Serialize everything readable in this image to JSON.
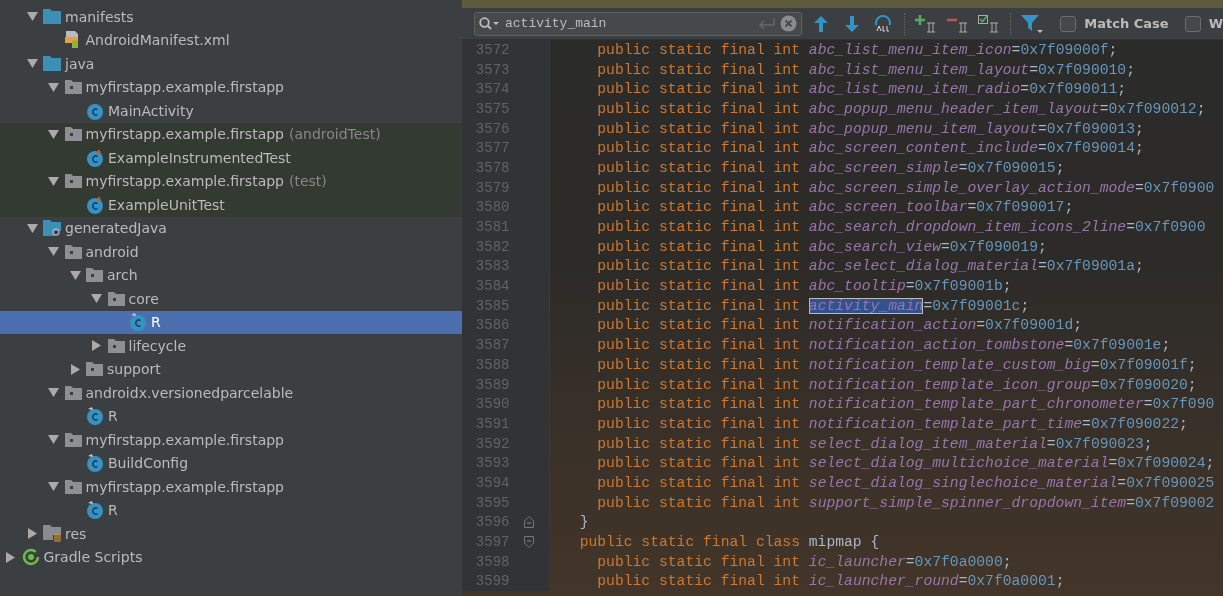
{
  "project_tree": [
    {
      "label": "manifests",
      "kind": "source-folder",
      "expanded": true,
      "selected": false,
      "test_scope": false,
      "children": [
        {
          "label": "AndroidManifest.xml",
          "kind": "manifest",
          "selected": false,
          "test_scope": false
        }
      ]
    },
    {
      "label": "java",
      "kind": "source-folder",
      "expanded": true,
      "selected": false,
      "test_scope": false,
      "children": [
        {
          "label": "myfirstapp.example.firstapp",
          "kind": "package",
          "expanded": true,
          "selected": false,
          "test_scope": false,
          "children": [
            {
              "label": "MainActivity",
              "kind": "class",
              "selected": false,
              "test_scope": false
            }
          ]
        },
        {
          "label": "myfirstapp.example.firstapp",
          "suffix": "(androidTest)",
          "kind": "package",
          "expanded": true,
          "selected": false,
          "test_scope": true,
          "children": [
            {
              "label": "ExampleInstrumentedTest",
              "kind": "test-class",
              "selected": false,
              "test_scope": true
            }
          ]
        },
        {
          "label": "myfirstapp.example.firstapp",
          "suffix": "(test)",
          "kind": "package",
          "expanded": true,
          "selected": false,
          "test_scope": true,
          "children": [
            {
              "label": "ExampleUnitTest",
              "kind": "test-class",
              "selected": false,
              "test_scope": true
            }
          ]
        }
      ]
    },
    {
      "label": "generatedJava",
      "kind": "generated-folder",
      "expanded": true,
      "selected": false,
      "test_scope": false,
      "children": [
        {
          "label": "android",
          "kind": "package",
          "expanded": true,
          "selected": false,
          "test_scope": false,
          "children": [
            {
              "label": "arch",
              "kind": "package",
              "expanded": true,
              "selected": false,
              "test_scope": false,
              "children": [
                {
                  "label": "core",
                  "kind": "package",
                  "expanded": true,
                  "selected": false,
                  "test_scope": false,
                  "children": [
                    {
                      "label": "R",
                      "kind": "generated-class",
                      "selected": true,
                      "test_scope": false
                    }
                  ]
                },
                {
                  "label": "lifecycle",
                  "kind": "package",
                  "expanded": false,
                  "selected": false,
                  "test_scope": false
                }
              ]
            },
            {
              "label": "support",
              "kind": "package",
              "expanded": false,
              "selected": false,
              "test_scope": false
            }
          ]
        },
        {
          "label": "androidx.versionedparcelable",
          "kind": "package",
          "expanded": true,
          "selected": false,
          "test_scope": false,
          "children": [
            {
              "label": "R",
              "kind": "generated-class",
              "selected": false,
              "test_scope": false
            }
          ]
        },
        {
          "label": "myfirstapp.example.firstapp",
          "kind": "package",
          "expanded": true,
          "selected": false,
          "test_scope": false,
          "children": [
            {
              "label": "BuildConfig",
              "kind": "generated-class",
              "selected": false,
              "test_scope": false
            }
          ]
        },
        {
          "label": "myfirstapp.example.firstapp",
          "kind": "package",
          "expanded": true,
          "selected": false,
          "test_scope": false,
          "children": [
            {
              "label": "R",
              "kind": "generated-class",
              "selected": false,
              "test_scope": false
            }
          ]
        }
      ]
    },
    {
      "label": "res",
      "kind": "resource-folder",
      "expanded": false,
      "selected": false,
      "test_scope": false
    }
  ],
  "gradle_scripts": {
    "label": "Gradle Scripts",
    "expanded": false
  },
  "search": {
    "value": "activity_main",
    "options": [
      {
        "label": "Match Case",
        "checked": false
      },
      {
        "label": "W",
        "checked": false
      }
    ]
  },
  "code": [
    {
      "number": "3572",
      "kind": "member",
      "parts": [
        {
          "kind": "keyword",
          "text": "public static final int"
        },
        {
          "kind": "field",
          "text": "abc_list_menu_item_icon"
        },
        {
          "kind": "plain",
          "text": "="
        },
        {
          "kind": "number",
          "text": "0x7f09000f"
        },
        {
          "kind": "plain",
          "text": ";"
        }
      ]
    },
    {
      "number": "3573",
      "kind": "member",
      "parts": [
        {
          "kind": "keyword",
          "text": "public static final int"
        },
        {
          "kind": "field",
          "text": "abc_list_menu_item_layout"
        },
        {
          "kind": "plain",
          "text": "="
        },
        {
          "kind": "number",
          "text": "0x7f090010"
        },
        {
          "kind": "plain",
          "text": ";"
        }
      ]
    },
    {
      "number": "3574",
      "kind": "member",
      "parts": [
        {
          "kind": "keyword",
          "text": "public static final int"
        },
        {
          "kind": "field",
          "text": "abc_list_menu_item_radio"
        },
        {
          "kind": "plain",
          "text": "="
        },
        {
          "kind": "number",
          "text": "0x7f090011"
        },
        {
          "kind": "plain",
          "text": ";"
        }
      ]
    },
    {
      "number": "3575",
      "kind": "member",
      "parts": [
        {
          "kind": "keyword",
          "text": "public static final int"
        },
        {
          "kind": "field",
          "text": "abc_popup_menu_header_item_layout"
        },
        {
          "kind": "plain",
          "text": "="
        },
        {
          "kind": "number",
          "text": "0x7f090012"
        },
        {
          "kind": "plain",
          "text": ";"
        }
      ]
    },
    {
      "number": "3576",
      "kind": "member",
      "parts": [
        {
          "kind": "keyword",
          "text": "public static final int"
        },
        {
          "kind": "field",
          "text": "abc_popup_menu_item_layout"
        },
        {
          "kind": "plain",
          "text": "="
        },
        {
          "kind": "number",
          "text": "0x7f090013"
        },
        {
          "kind": "plain",
          "text": ";"
        }
      ]
    },
    {
      "number": "3577",
      "kind": "member",
      "parts": [
        {
          "kind": "keyword",
          "text": "public static final int"
        },
        {
          "kind": "field",
          "text": "abc_screen_content_include"
        },
        {
          "kind": "plain",
          "text": "="
        },
        {
          "kind": "number",
          "text": "0x7f090014"
        },
        {
          "kind": "plain",
          "text": ";"
        }
      ]
    },
    {
      "number": "3578",
      "kind": "member",
      "parts": [
        {
          "kind": "keyword",
          "text": "public static final int"
        },
        {
          "kind": "field",
          "text": "abc_screen_simple"
        },
        {
          "kind": "plain",
          "text": "="
        },
        {
          "kind": "number",
          "text": "0x7f090015"
        },
        {
          "kind": "plain",
          "text": ";"
        }
      ]
    },
    {
      "number": "3579",
      "kind": "member",
      "parts": [
        {
          "kind": "keyword",
          "text": "public static final int"
        },
        {
          "kind": "field",
          "text": "abc_screen_simple_overlay_action_mode"
        },
        {
          "kind": "plain",
          "text": "="
        },
        {
          "kind": "number",
          "text": "0x7f0900"
        }
      ]
    },
    {
      "number": "3580",
      "kind": "member",
      "parts": [
        {
          "kind": "keyword",
          "text": "public static final int"
        },
        {
          "kind": "field",
          "text": "abc_screen_toolbar"
        },
        {
          "kind": "plain",
          "text": "="
        },
        {
          "kind": "number",
          "text": "0x7f090017"
        },
        {
          "kind": "plain",
          "text": ";"
        }
      ]
    },
    {
      "number": "3581",
      "kind": "member",
      "parts": [
        {
          "kind": "keyword",
          "text": "public static final int"
        },
        {
          "kind": "field",
          "text": "abc_search_dropdown_item_icons_2line"
        },
        {
          "kind": "plain",
          "text": "="
        },
        {
          "kind": "number",
          "text": "0x7f0900"
        }
      ]
    },
    {
      "number": "3582",
      "kind": "member",
      "parts": [
        {
          "kind": "keyword",
          "text": "public static final int"
        },
        {
          "kind": "field",
          "text": "abc_search_view"
        },
        {
          "kind": "plain",
          "text": "="
        },
        {
          "kind": "number",
          "text": "0x7f090019"
        },
        {
          "kind": "plain",
          "text": ";"
        }
      ]
    },
    {
      "number": "3583",
      "kind": "member",
      "parts": [
        {
          "kind": "keyword",
          "text": "public static final int"
        },
        {
          "kind": "field",
          "text": "abc_select_dialog_material"
        },
        {
          "kind": "plain",
          "text": "="
        },
        {
          "kind": "number",
          "text": "0x7f09001a"
        },
        {
          "kind": "plain",
          "text": ";"
        }
      ]
    },
    {
      "number": "3584",
      "kind": "member",
      "parts": [
        {
          "kind": "keyword",
          "text": "public static final int"
        },
        {
          "kind": "field",
          "text": "abc_tooltip"
        },
        {
          "kind": "plain",
          "text": "="
        },
        {
          "kind": "number",
          "text": "0x7f09001b"
        },
        {
          "kind": "plain",
          "text": ";"
        }
      ]
    },
    {
      "number": "3585",
      "kind": "member",
      "parts": [
        {
          "kind": "keyword",
          "text": "public static final int"
        },
        {
          "kind": "match",
          "text": "activity_main"
        },
        {
          "kind": "plain",
          "text": "="
        },
        {
          "kind": "number",
          "text": "0x7f09001c"
        },
        {
          "kind": "plain",
          "text": ";"
        }
      ]
    },
    {
      "number": "3586",
      "kind": "member",
      "parts": [
        {
          "kind": "keyword",
          "text": "public static final int"
        },
        {
          "kind": "field",
          "text": "notification_action"
        },
        {
          "kind": "plain",
          "text": "="
        },
        {
          "kind": "number",
          "text": "0x7f09001d"
        },
        {
          "kind": "plain",
          "text": ";"
        }
      ]
    },
    {
      "number": "3587",
      "kind": "member",
      "parts": [
        {
          "kind": "keyword",
          "text": "public static final int"
        },
        {
          "kind": "field",
          "text": "notification_action_tombstone"
        },
        {
          "kind": "plain",
          "text": "="
        },
        {
          "kind": "number",
          "text": "0x7f09001e"
        },
        {
          "kind": "plain",
          "text": ";"
        }
      ]
    },
    {
      "number": "3588",
      "kind": "member",
      "parts": [
        {
          "kind": "keyword",
          "text": "public static final int"
        },
        {
          "kind": "field",
          "text": "notification_template_custom_big"
        },
        {
          "kind": "plain",
          "text": "="
        },
        {
          "kind": "number",
          "text": "0x7f09001f"
        },
        {
          "kind": "plain",
          "text": ";"
        }
      ]
    },
    {
      "number": "3589",
      "kind": "member",
      "parts": [
        {
          "kind": "keyword",
          "text": "public static final int"
        },
        {
          "kind": "field",
          "text": "notification_template_icon_group"
        },
        {
          "kind": "plain",
          "text": "="
        },
        {
          "kind": "number",
          "text": "0x7f090020"
        },
        {
          "kind": "plain",
          "text": ";"
        }
      ]
    },
    {
      "number": "3590",
      "kind": "member",
      "parts": [
        {
          "kind": "keyword",
          "text": "public static final int"
        },
        {
          "kind": "field",
          "text": "notification_template_part_chronometer"
        },
        {
          "kind": "plain",
          "text": "="
        },
        {
          "kind": "number",
          "text": "0x7f090"
        }
      ]
    },
    {
      "number": "3591",
      "kind": "member",
      "parts": [
        {
          "kind": "keyword",
          "text": "public static final int"
        },
        {
          "kind": "field",
          "text": "notification_template_part_time"
        },
        {
          "kind": "plain",
          "text": "="
        },
        {
          "kind": "number",
          "text": "0x7f090022"
        },
        {
          "kind": "plain",
          "text": ";"
        }
      ]
    },
    {
      "number": "3592",
      "kind": "member",
      "parts": [
        {
          "kind": "keyword",
          "text": "public static final int"
        },
        {
          "kind": "field",
          "text": "select_dialog_item_material"
        },
        {
          "kind": "plain",
          "text": "="
        },
        {
          "kind": "number",
          "text": "0x7f090023"
        },
        {
          "kind": "plain",
          "text": ";"
        }
      ]
    },
    {
      "number": "3593",
      "kind": "member",
      "parts": [
        {
          "kind": "keyword",
          "text": "public static final int"
        },
        {
          "kind": "field",
          "text": "select_dialog_multichoice_material"
        },
        {
          "kind": "plain",
          "text": "="
        },
        {
          "kind": "number",
          "text": "0x7f090024"
        },
        {
          "kind": "plain",
          "text": ";"
        }
      ]
    },
    {
      "number": "3594",
      "kind": "member",
      "parts": [
        {
          "kind": "keyword",
          "text": "public static final int"
        },
        {
          "kind": "field",
          "text": "select_dialog_singlechoice_material"
        },
        {
          "kind": "plain",
          "text": "="
        },
        {
          "kind": "number",
          "text": "0x7f090025"
        }
      ]
    },
    {
      "number": "3595",
      "kind": "member",
      "parts": [
        {
          "kind": "keyword",
          "text": "public static final int"
        },
        {
          "kind": "field",
          "text": "support_simple_spinner_dropdown_item"
        },
        {
          "kind": "plain",
          "text": "="
        },
        {
          "kind": "number",
          "text": "0x7f09002"
        }
      ]
    },
    {
      "number": "3596",
      "kind": "brace",
      "parts": [
        {
          "kind": "plain",
          "text": "}"
        }
      ]
    },
    {
      "number": "3597",
      "kind": "class",
      "parts": [
        {
          "kind": "keyword",
          "text": "public static final class"
        },
        {
          "kind": "plain",
          "text": "mipmap {"
        }
      ]
    },
    {
      "number": "3598",
      "kind": "member",
      "parts": [
        {
          "kind": "keyword",
          "text": "public static final int"
        },
        {
          "kind": "field",
          "text": "ic_launcher"
        },
        {
          "kind": "plain",
          "text": "="
        },
        {
          "kind": "number",
          "text": "0x7f0a0000"
        },
        {
          "kind": "plain",
          "text": ";"
        }
      ]
    },
    {
      "number": "3599",
      "kind": "member",
      "parts": [
        {
          "kind": "keyword",
          "text": "public static final int"
        },
        {
          "kind": "field",
          "text": "ic_launcher_round"
        },
        {
          "kind": "plain",
          "text": "="
        },
        {
          "kind": "number",
          "text": "0x7f0a0001"
        },
        {
          "kind": "plain",
          "text": ";"
        }
      ]
    }
  ]
}
